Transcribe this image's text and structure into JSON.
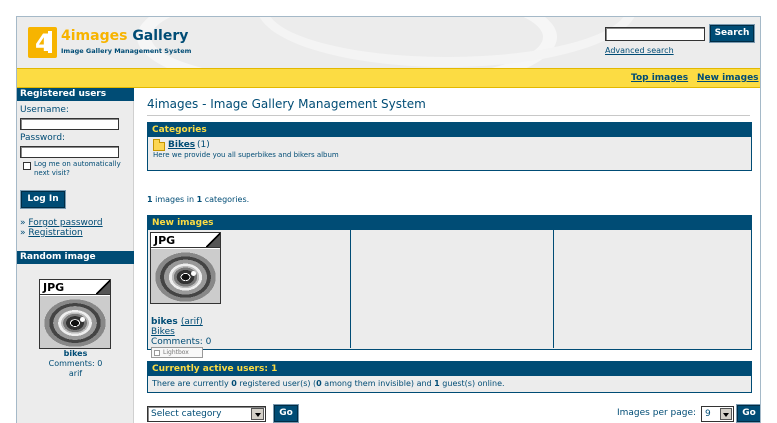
{
  "header": {
    "logo_title_part1": "4images",
    "logo_title_part2": "Gallery",
    "logo_subtitle": "Image Gallery Management System",
    "search_button": "Search",
    "search_value": "",
    "advanced_search": "Advanced search"
  },
  "nav": {
    "top_images": "Top images",
    "new_images": "New images"
  },
  "sidebar": {
    "registered_users_title": "Registered users",
    "username_label": "Username:",
    "password_label": "Password:",
    "remember_label": "Log me on automatically next visit?",
    "login_button": "Log In",
    "forgot_password": "Forgot password",
    "registration": "Registration",
    "bullet": "»",
    "random_image_title": "Random image",
    "random_image": {
      "format": "JPG",
      "name": "bikes",
      "comments": "Comments: 0",
      "user": "arif"
    }
  },
  "main": {
    "page_title": "4images - Image Gallery Management System",
    "categories_title": "Categories",
    "category": {
      "name": "Bikes",
      "count": "(1)",
      "description": "Here we provide you all superbikes and bikers album"
    },
    "summary": {
      "images_count": "1",
      "images_text": " images in ",
      "categories_count": "1",
      "categories_text": " categories."
    },
    "new_images_title": "New images",
    "new_image": {
      "format": "JPG",
      "name": "bikes",
      "user": "(arif)",
      "category": "Bikes",
      "comments": "Comments: 0",
      "lightbox": "Lightbox"
    },
    "active_users_title": "Currently active users: 1",
    "active_users": {
      "p1": "There are currently ",
      "registered": "0",
      "p2": " registered user(s) (",
      "invisible": "0",
      "p3": " among them invisible) and ",
      "guests": "1",
      "p4": " guest(s) online."
    },
    "select_category": "Select category",
    "go_button": "Go",
    "images_per_page_label": "Images per page:",
    "images_per_page_value": "9"
  },
  "colors": {
    "brand_blue": "#004c75",
    "brand_yellow": "#fcdc43",
    "logo_orange": "#f7b400",
    "panel_gray": "#ececec"
  }
}
